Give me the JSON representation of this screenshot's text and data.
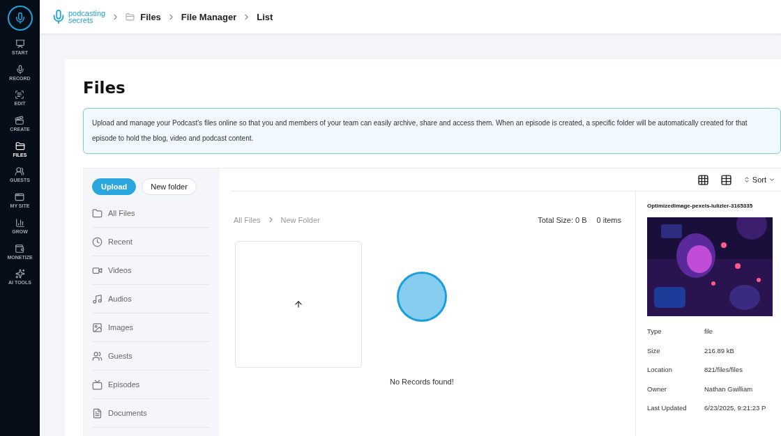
{
  "nav": [
    {
      "label": "START",
      "selected": false
    },
    {
      "label": "RECORD",
      "selected": false
    },
    {
      "label": "EDIT",
      "selected": false
    },
    {
      "label": "CREATE",
      "selected": false
    },
    {
      "label": "FILES",
      "selected": true
    },
    {
      "label": "GUESTS",
      "selected": false
    },
    {
      "label": "MY SITE",
      "selected": false
    },
    {
      "label": "GROW",
      "selected": false
    },
    {
      "label": "MONETIZE",
      "selected": false
    },
    {
      "label": "AI TOOLS",
      "selected": false
    }
  ],
  "header": {
    "logo": [
      "podcasting",
      "secrets"
    ],
    "breadcrumbs": [
      "Files",
      "File Manager",
      "List"
    ]
  },
  "page": {
    "title": "Files",
    "info": "Upload and manage your Podcast's files online so that you and members of your team can easily archive, share and access them. When an episode is created, a specific folder will be automatically created for that episode to hold the blog, video and podcast content."
  },
  "actions": {
    "upload": "Upload",
    "new_folder": "New folder"
  },
  "folders": [
    "All Files",
    "Recent",
    "Videos",
    "Audios",
    "Images",
    "Guests",
    "Episodes",
    "Documents"
  ],
  "toolbar": {
    "sort": "Sort"
  },
  "path": [
    "All Files",
    "New Folder"
  ],
  "summary": {
    "total": "Total Size: 0 B",
    "count": "0 items"
  },
  "empty": "No Records found!",
  "details": {
    "name": "OptimizedImage-pexels-lulizler-3165335",
    "rows": [
      {
        "label": "Type",
        "value": "file"
      },
      {
        "label": "Size",
        "value": "216.89 kB"
      },
      {
        "label": "Location",
        "value": "821/files/files"
      },
      {
        "label": "Owner",
        "value": "Nathan Gwilliam"
      },
      {
        "label": "Last Updated",
        "value": "6/23/2025, 9:21:23 P"
      }
    ]
  }
}
